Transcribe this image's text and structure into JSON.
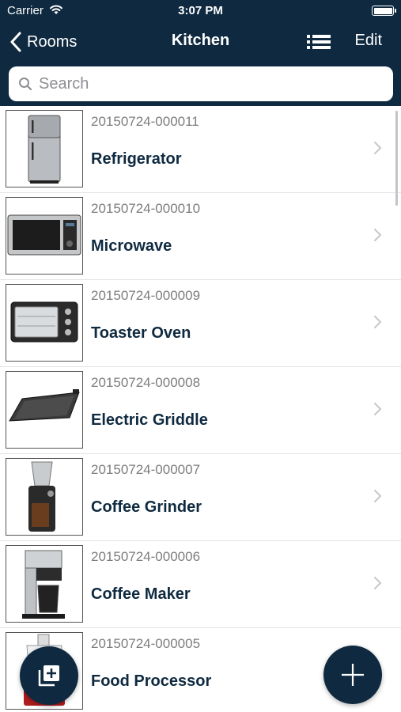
{
  "status_bar": {
    "carrier": "Carrier",
    "time": "3:07 PM",
    "wifi_icon": "wifi-icon",
    "battery_icon": "battery-icon"
  },
  "nav": {
    "back_label": "Rooms",
    "title": "Kitchen",
    "list_icon": "list-view-icon",
    "edit_label": "Edit"
  },
  "search": {
    "placeholder": "Search",
    "value": ""
  },
  "items": [
    {
      "id": "20150724-000011",
      "name": "Refrigerator",
      "thumb_icon": "refrigerator-icon"
    },
    {
      "id": "20150724-000010",
      "name": "Microwave",
      "thumb_icon": "microwave-icon"
    },
    {
      "id": "20150724-000009",
      "name": "Toaster Oven",
      "thumb_icon": "toaster-oven-icon"
    },
    {
      "id": "20150724-000008",
      "name": "Electric Griddle",
      "thumb_icon": "griddle-icon"
    },
    {
      "id": "20150724-000007",
      "name": "Coffee Grinder",
      "thumb_icon": "coffee-grinder-icon"
    },
    {
      "id": "20150724-000006",
      "name": "Coffee Maker",
      "thumb_icon": "coffee-maker-icon"
    },
    {
      "id": "20150724-000005",
      "name": "Food Processor",
      "thumb_icon": "food-processor-icon"
    }
  ],
  "fabs": {
    "left_icon": "add-photo-icon",
    "right_icon": "plus-icon"
  },
  "colors": {
    "nav_background": "#0f2a40",
    "item_name": "#0f2a40",
    "item_id": "#7d7d7d",
    "separator": "#e4e4e8"
  }
}
